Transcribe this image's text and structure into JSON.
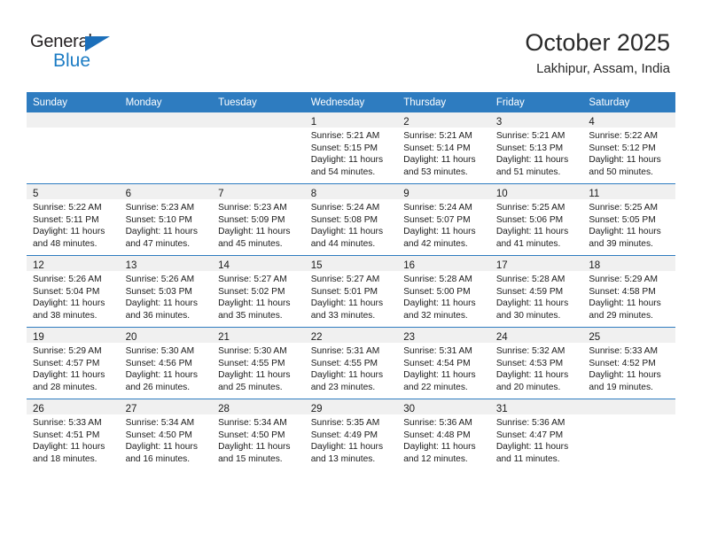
{
  "brand": {
    "name_part1": "General",
    "name_part2": "Blue",
    "triangle_color": "#1c6fba",
    "blue_text_color": "#1c7cc4"
  },
  "header": {
    "title": "October 2025",
    "subtitle": "Lakhipur, Assam, India"
  },
  "theme": {
    "header_row_color": "#2e7cc0",
    "daynum_strip_color": "#f0f0f0",
    "grid_line_color": "#2e7cc0"
  },
  "weekday_headers": [
    "Sunday",
    "Monday",
    "Tuesday",
    "Wednesday",
    "Thursday",
    "Friday",
    "Saturday"
  ],
  "weeks": [
    [
      {
        "day": "",
        "empty": true,
        "sunrise": "",
        "sunset": "",
        "daylight_line1": "",
        "daylight_line2": ""
      },
      {
        "day": "",
        "empty": true,
        "sunrise": "",
        "sunset": "",
        "daylight_line1": "",
        "daylight_line2": ""
      },
      {
        "day": "",
        "empty": true,
        "sunrise": "",
        "sunset": "",
        "daylight_line1": "",
        "daylight_line2": ""
      },
      {
        "day": "1",
        "empty": false,
        "sunrise": "Sunrise: 5:21 AM",
        "sunset": "Sunset: 5:15 PM",
        "daylight_line1": "Daylight: 11 hours",
        "daylight_line2": "and 54 minutes."
      },
      {
        "day": "2",
        "empty": false,
        "sunrise": "Sunrise: 5:21 AM",
        "sunset": "Sunset: 5:14 PM",
        "daylight_line1": "Daylight: 11 hours",
        "daylight_line2": "and 53 minutes."
      },
      {
        "day": "3",
        "empty": false,
        "sunrise": "Sunrise: 5:21 AM",
        "sunset": "Sunset: 5:13 PM",
        "daylight_line1": "Daylight: 11 hours",
        "daylight_line2": "and 51 minutes."
      },
      {
        "day": "4",
        "empty": false,
        "sunrise": "Sunrise: 5:22 AM",
        "sunset": "Sunset: 5:12 PM",
        "daylight_line1": "Daylight: 11 hours",
        "daylight_line2": "and 50 minutes."
      }
    ],
    [
      {
        "day": "5",
        "empty": false,
        "sunrise": "Sunrise: 5:22 AM",
        "sunset": "Sunset: 5:11 PM",
        "daylight_line1": "Daylight: 11 hours",
        "daylight_line2": "and 48 minutes."
      },
      {
        "day": "6",
        "empty": false,
        "sunrise": "Sunrise: 5:23 AM",
        "sunset": "Sunset: 5:10 PM",
        "daylight_line1": "Daylight: 11 hours",
        "daylight_line2": "and 47 minutes."
      },
      {
        "day": "7",
        "empty": false,
        "sunrise": "Sunrise: 5:23 AM",
        "sunset": "Sunset: 5:09 PM",
        "daylight_line1": "Daylight: 11 hours",
        "daylight_line2": "and 45 minutes."
      },
      {
        "day": "8",
        "empty": false,
        "sunrise": "Sunrise: 5:24 AM",
        "sunset": "Sunset: 5:08 PM",
        "daylight_line1": "Daylight: 11 hours",
        "daylight_line2": "and 44 minutes."
      },
      {
        "day": "9",
        "empty": false,
        "sunrise": "Sunrise: 5:24 AM",
        "sunset": "Sunset: 5:07 PM",
        "daylight_line1": "Daylight: 11 hours",
        "daylight_line2": "and 42 minutes."
      },
      {
        "day": "10",
        "empty": false,
        "sunrise": "Sunrise: 5:25 AM",
        "sunset": "Sunset: 5:06 PM",
        "daylight_line1": "Daylight: 11 hours",
        "daylight_line2": "and 41 minutes."
      },
      {
        "day": "11",
        "empty": false,
        "sunrise": "Sunrise: 5:25 AM",
        "sunset": "Sunset: 5:05 PM",
        "daylight_line1": "Daylight: 11 hours",
        "daylight_line2": "and 39 minutes."
      }
    ],
    [
      {
        "day": "12",
        "empty": false,
        "sunrise": "Sunrise: 5:26 AM",
        "sunset": "Sunset: 5:04 PM",
        "daylight_line1": "Daylight: 11 hours",
        "daylight_line2": "and 38 minutes."
      },
      {
        "day": "13",
        "empty": false,
        "sunrise": "Sunrise: 5:26 AM",
        "sunset": "Sunset: 5:03 PM",
        "daylight_line1": "Daylight: 11 hours",
        "daylight_line2": "and 36 minutes."
      },
      {
        "day": "14",
        "empty": false,
        "sunrise": "Sunrise: 5:27 AM",
        "sunset": "Sunset: 5:02 PM",
        "daylight_line1": "Daylight: 11 hours",
        "daylight_line2": "and 35 minutes."
      },
      {
        "day": "15",
        "empty": false,
        "sunrise": "Sunrise: 5:27 AM",
        "sunset": "Sunset: 5:01 PM",
        "daylight_line1": "Daylight: 11 hours",
        "daylight_line2": "and 33 minutes."
      },
      {
        "day": "16",
        "empty": false,
        "sunrise": "Sunrise: 5:28 AM",
        "sunset": "Sunset: 5:00 PM",
        "daylight_line1": "Daylight: 11 hours",
        "daylight_line2": "and 32 minutes."
      },
      {
        "day": "17",
        "empty": false,
        "sunrise": "Sunrise: 5:28 AM",
        "sunset": "Sunset: 4:59 PM",
        "daylight_line1": "Daylight: 11 hours",
        "daylight_line2": "and 30 minutes."
      },
      {
        "day": "18",
        "empty": false,
        "sunrise": "Sunrise: 5:29 AM",
        "sunset": "Sunset: 4:58 PM",
        "daylight_line1": "Daylight: 11 hours",
        "daylight_line2": "and 29 minutes."
      }
    ],
    [
      {
        "day": "19",
        "empty": false,
        "sunrise": "Sunrise: 5:29 AM",
        "sunset": "Sunset: 4:57 PM",
        "daylight_line1": "Daylight: 11 hours",
        "daylight_line2": "and 28 minutes."
      },
      {
        "day": "20",
        "empty": false,
        "sunrise": "Sunrise: 5:30 AM",
        "sunset": "Sunset: 4:56 PM",
        "daylight_line1": "Daylight: 11 hours",
        "daylight_line2": "and 26 minutes."
      },
      {
        "day": "21",
        "empty": false,
        "sunrise": "Sunrise: 5:30 AM",
        "sunset": "Sunset: 4:55 PM",
        "daylight_line1": "Daylight: 11 hours",
        "daylight_line2": "and 25 minutes."
      },
      {
        "day": "22",
        "empty": false,
        "sunrise": "Sunrise: 5:31 AM",
        "sunset": "Sunset: 4:55 PM",
        "daylight_line1": "Daylight: 11 hours",
        "daylight_line2": "and 23 minutes."
      },
      {
        "day": "23",
        "empty": false,
        "sunrise": "Sunrise: 5:31 AM",
        "sunset": "Sunset: 4:54 PM",
        "daylight_line1": "Daylight: 11 hours",
        "daylight_line2": "and 22 minutes."
      },
      {
        "day": "24",
        "empty": false,
        "sunrise": "Sunrise: 5:32 AM",
        "sunset": "Sunset: 4:53 PM",
        "daylight_line1": "Daylight: 11 hours",
        "daylight_line2": "and 20 minutes."
      },
      {
        "day": "25",
        "empty": false,
        "sunrise": "Sunrise: 5:33 AM",
        "sunset": "Sunset: 4:52 PM",
        "daylight_line1": "Daylight: 11 hours",
        "daylight_line2": "and 19 minutes."
      }
    ],
    [
      {
        "day": "26",
        "empty": false,
        "sunrise": "Sunrise: 5:33 AM",
        "sunset": "Sunset: 4:51 PM",
        "daylight_line1": "Daylight: 11 hours",
        "daylight_line2": "and 18 minutes."
      },
      {
        "day": "27",
        "empty": false,
        "sunrise": "Sunrise: 5:34 AM",
        "sunset": "Sunset: 4:50 PM",
        "daylight_line1": "Daylight: 11 hours",
        "daylight_line2": "and 16 minutes."
      },
      {
        "day": "28",
        "empty": false,
        "sunrise": "Sunrise: 5:34 AM",
        "sunset": "Sunset: 4:50 PM",
        "daylight_line1": "Daylight: 11 hours",
        "daylight_line2": "and 15 minutes."
      },
      {
        "day": "29",
        "empty": false,
        "sunrise": "Sunrise: 5:35 AM",
        "sunset": "Sunset: 4:49 PM",
        "daylight_line1": "Daylight: 11 hours",
        "daylight_line2": "and 13 minutes."
      },
      {
        "day": "30",
        "empty": false,
        "sunrise": "Sunrise: 5:36 AM",
        "sunset": "Sunset: 4:48 PM",
        "daylight_line1": "Daylight: 11 hours",
        "daylight_line2": "and 12 minutes."
      },
      {
        "day": "31",
        "empty": false,
        "sunrise": "Sunrise: 5:36 AM",
        "sunset": "Sunset: 4:47 PM",
        "daylight_line1": "Daylight: 11 hours",
        "daylight_line2": "and 11 minutes."
      },
      {
        "day": "",
        "empty": true,
        "sunrise": "",
        "sunset": "",
        "daylight_line1": "",
        "daylight_line2": ""
      }
    ]
  ]
}
